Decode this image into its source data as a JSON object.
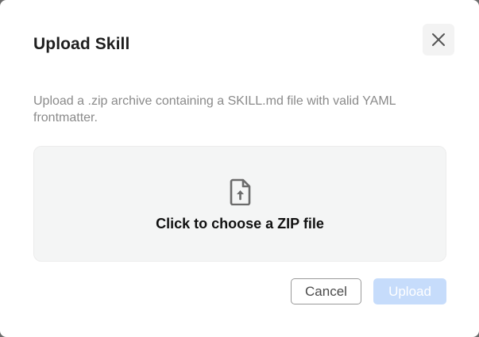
{
  "dialog": {
    "title": "Upload Skill",
    "close_icon": "close-icon",
    "description": "Upload a .zip archive containing a SKILL.md file with valid YAML frontmatter.",
    "dropzone": {
      "icon": "file-upload-icon",
      "label": "Click to choose a ZIP file"
    },
    "actions": {
      "cancel_label": "Cancel",
      "upload_label": "Upload",
      "upload_disabled": true
    }
  },
  "colors": {
    "primary_disabled": "#c6dcfb",
    "text_muted": "#8a8a8a",
    "dropzone_bg": "#f4f5f5"
  }
}
